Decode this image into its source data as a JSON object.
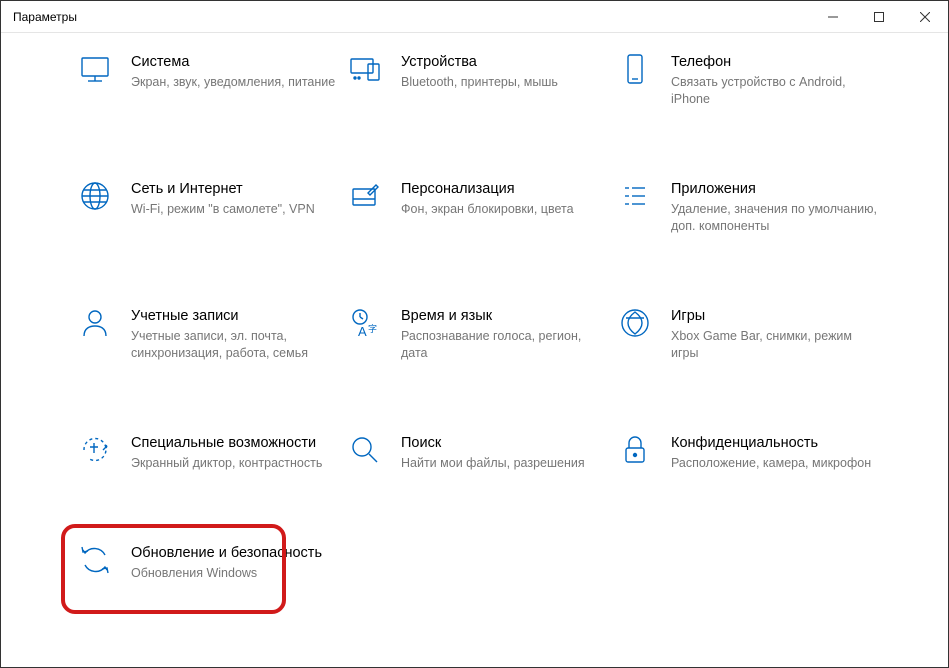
{
  "window": {
    "title": "Параметры"
  },
  "tiles": [
    {
      "title": "Система",
      "sub": "Экран, звук, уведомления, питание"
    },
    {
      "title": "Устройства",
      "sub": "Bluetooth, принтеры, мышь"
    },
    {
      "title": "Телефон",
      "sub": "Связать устройство с Android, iPhone"
    },
    {
      "title": "Сеть и Интернет",
      "sub": "Wi-Fi, режим \"в самолете\", VPN"
    },
    {
      "title": "Персонализация",
      "sub": "Фон, экран блокировки, цвета"
    },
    {
      "title": "Приложения",
      "sub": "Удаление, значения по умолчанию, доп. компоненты"
    },
    {
      "title": "Учетные записи",
      "sub": "Учетные записи, эл. почта, синхронизация, работа, семья"
    },
    {
      "title": "Время и язык",
      "sub": "Распознавание голоса, регион, дата"
    },
    {
      "title": "Игры",
      "sub": "Xbox Game Bar, снимки, режим игры"
    },
    {
      "title": "Специальные возможности",
      "sub": "Экранный диктор, контрастность"
    },
    {
      "title": "Поиск",
      "sub": "Найти мои файлы, разрешения"
    },
    {
      "title": "Конфиденциальность",
      "sub": "Расположение, камера, микрофон"
    },
    {
      "title": "Обновление и безопасность",
      "sub": "Обновления Windows"
    }
  ]
}
